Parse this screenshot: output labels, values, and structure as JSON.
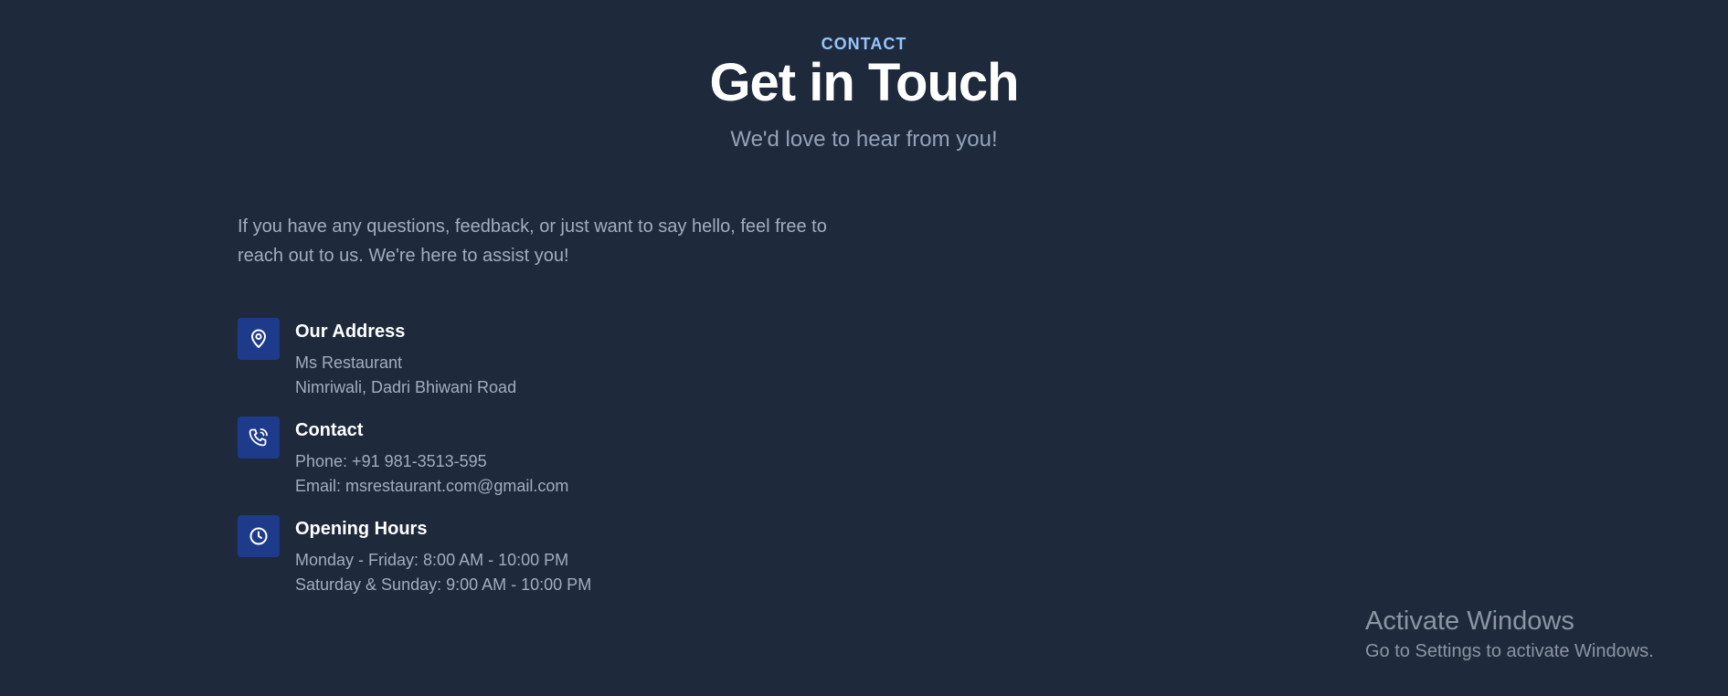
{
  "header": {
    "eyebrow": "CONTACT",
    "title": "Get in Touch",
    "subtitle": "We'd love to hear from you!"
  },
  "intro": "If you have any questions, feedback, or just want to say hello, feel free to reach out to us. We're here to assist you!",
  "info": [
    {
      "icon": "map-pin-icon",
      "title": "Our Address",
      "lines": [
        "Ms Restaurant",
        "Nimriwali, Dadri Bhiwani Road"
      ]
    },
    {
      "icon": "phone-icon",
      "title": "Contact",
      "lines": [
        "Phone: +91 981-3513-595",
        "Email: msrestaurant.com@gmail.com"
      ]
    },
    {
      "icon": "clock-icon",
      "title": "Opening Hours",
      "lines": [
        "Monday - Friday: 8:00 AM - 10:00 PM",
        "Saturday & Sunday: 9:00 AM - 10:00 PM"
      ]
    }
  ],
  "watermark": {
    "title": "Activate Windows",
    "subtitle": "Go to Settings to activate Windows."
  },
  "colors": {
    "background": "#1e293b",
    "accent": "#93c5fd",
    "icon_box": "#1e3a8a"
  }
}
